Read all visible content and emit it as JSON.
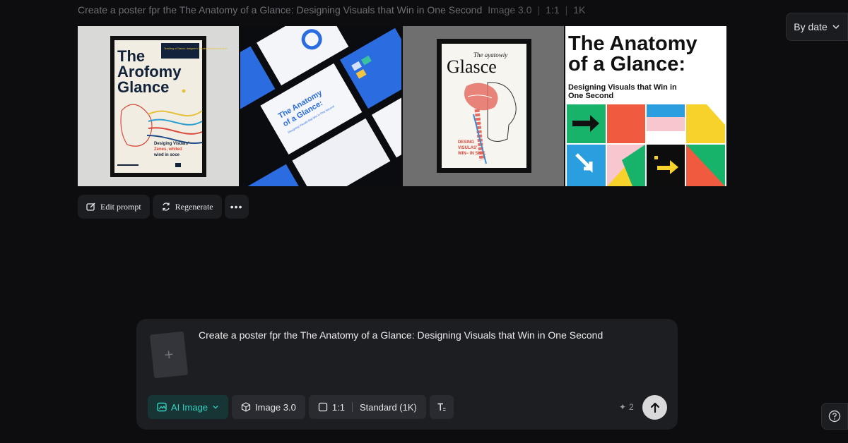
{
  "header": {
    "prompt_preview": "Create a poster fpr the The Anatomy of a Glance: Designing Visuals that Win in One Second",
    "model": "Image 3.0",
    "ratio": "1:1",
    "resolution": "1K",
    "sort_label": "By date"
  },
  "images": {
    "img1": {
      "title_line1": "The",
      "title_line2": "Arofomy",
      "title_line3": "Glance",
      "sub1": "Desiging Visuals°",
      "sub2": "Zenes, whited",
      "sub3": "wind in soce",
      "corner": "Teechieg of Glance, designer's Visuals who fore new time."
    },
    "img2": {
      "title1": "The Anatomy",
      "title2": "of a Glance:",
      "sub": "Designing Visuals that Win in One Second"
    },
    "img3": {
      "top": "The ayatowiy",
      "title": "Glasce",
      "sub1": "DESING",
      "sub2": "VISULAS'",
      "sub3": "WIN− IN SICE."
    },
    "img4": {
      "title1": "The Anatomy",
      "title2": "of a Glance:",
      "sub1": "Designing Visuals that Win in",
      "sub2": "One Second"
    }
  },
  "actions": {
    "edit": "Edit prompt",
    "regenerate": "Regenerate",
    "more": "•••"
  },
  "composer": {
    "upload_plus": "+",
    "prompt": "Create a poster fpr the The Anatomy of a Glance: Designing Visuals that Win in One Second",
    "ai_image": "AI Image",
    "model": "Image 3.0",
    "ratio": "1:1",
    "quality": "Standard (1K)",
    "credits": "2"
  },
  "colors": {
    "accent": "#35d2c3",
    "background": "#0d0d0f",
    "panel": "#1d1e22"
  }
}
